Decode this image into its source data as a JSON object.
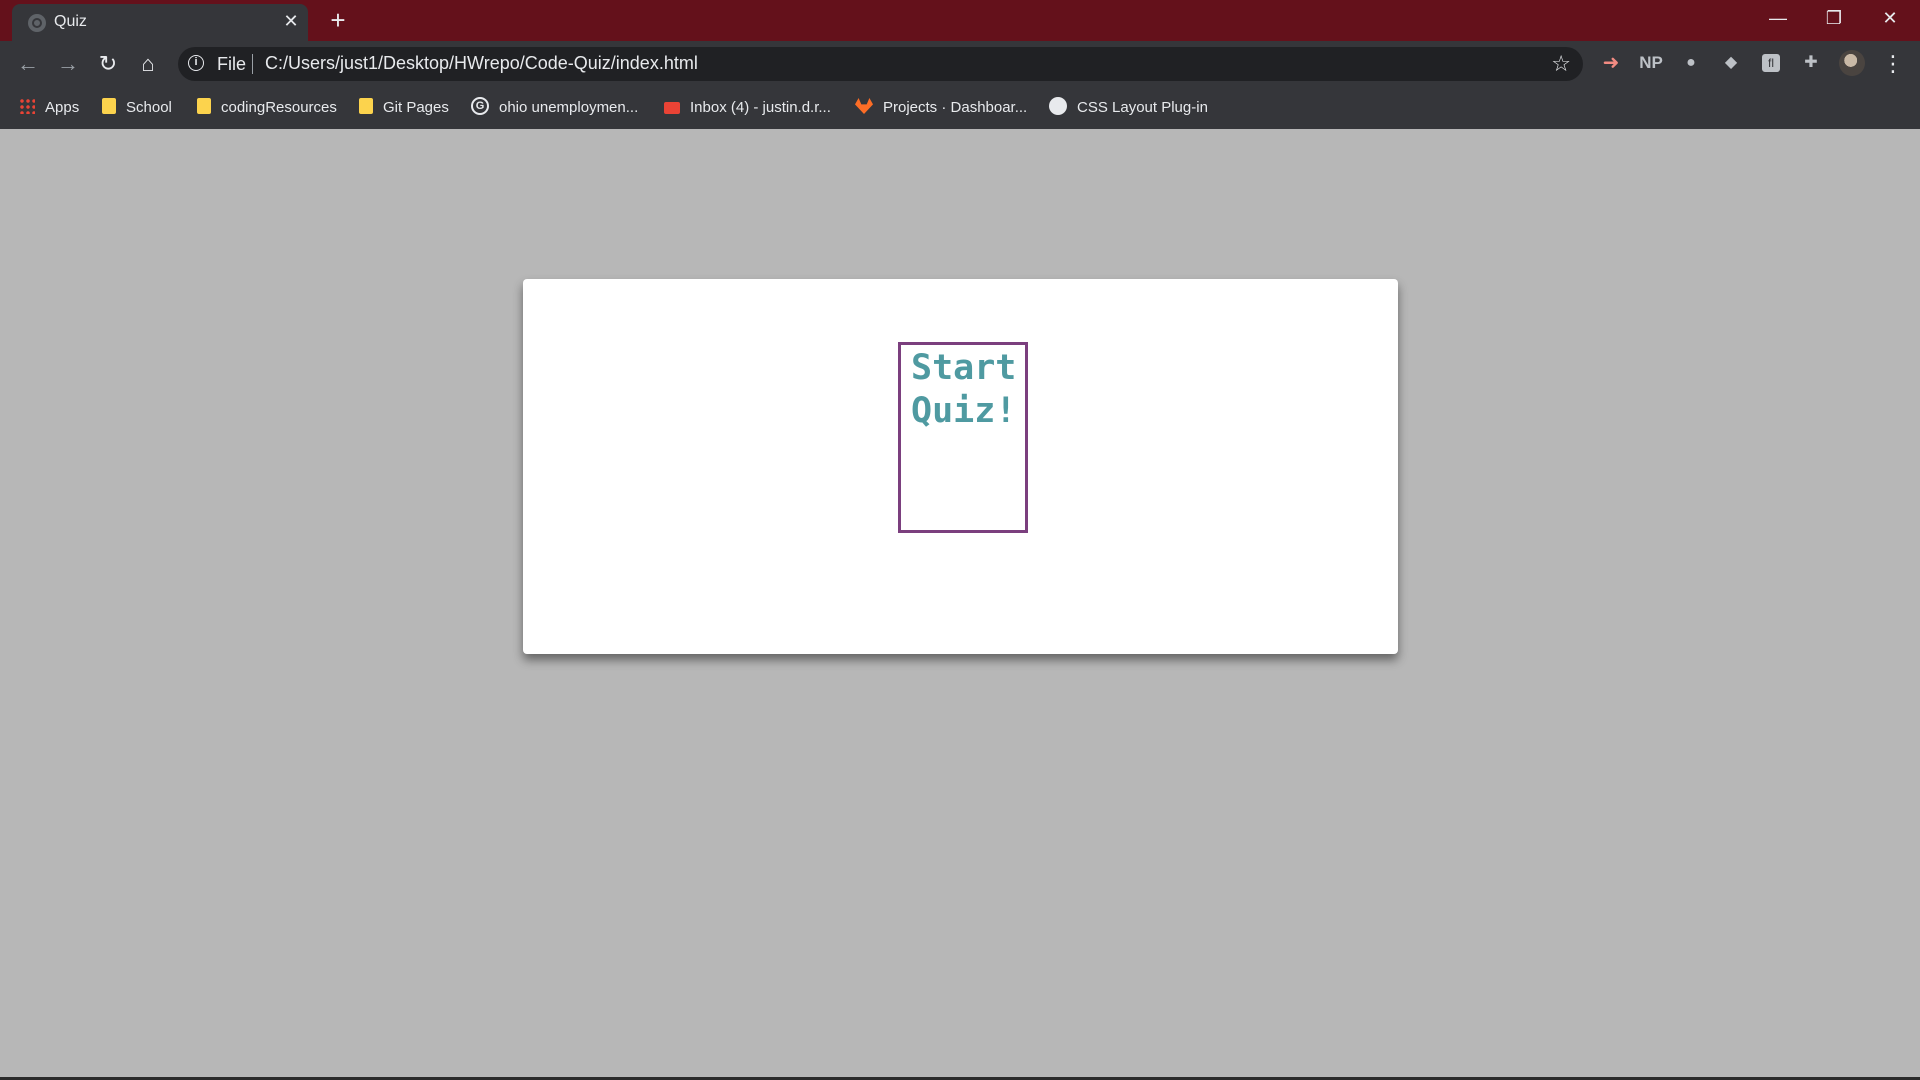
{
  "browser": {
    "tab_title": "Quiz",
    "tab_close": "✕",
    "new_tab": "+",
    "window_controls": {
      "minimize": "—",
      "restore": "❐",
      "close": "✕"
    },
    "nav": {
      "back": "←",
      "forward": "→",
      "reload": "↻",
      "home": "⌂"
    },
    "omnibox": {
      "info": "i",
      "scheme_label": "File",
      "url": "C:/Users/just1/Desktop/HWrepo/Code-Quiz/index.html",
      "star": "☆"
    },
    "extensions": {
      "ext1": "➜",
      "ext2": "NP",
      "ext3": "●",
      "ext4": "◆",
      "ext5": "fl",
      "ext6": "✚"
    },
    "menu": "⋮",
    "bookmarks": [
      {
        "label": "Apps",
        "icon": "apps-grid-icon"
      },
      {
        "label": "School",
        "icon": "folder-icon"
      },
      {
        "label": "codingResources",
        "icon": "folder-icon"
      },
      {
        "label": "Git Pages",
        "icon": "folder-icon"
      },
      {
        "label": "ohio unemploymen...",
        "icon": "google-icon"
      },
      {
        "label": "Inbox (4) - justin.d.r...",
        "icon": "gmail-icon"
      },
      {
        "label": "Projects · Dashboar...",
        "icon": "gitlab-icon"
      },
      {
        "label": "CSS Layout Plug-in",
        "icon": "globe-icon"
      }
    ],
    "colors": {
      "tab_strip": "#64111b",
      "toolbar": "#35363a",
      "page_bg": "#b7b7b7"
    }
  },
  "quiz": {
    "start_label": "Start Quiz!",
    "colors": {
      "text": "#4f9aa1",
      "border": "#7b3f7e",
      "card": "#ffffff"
    }
  }
}
